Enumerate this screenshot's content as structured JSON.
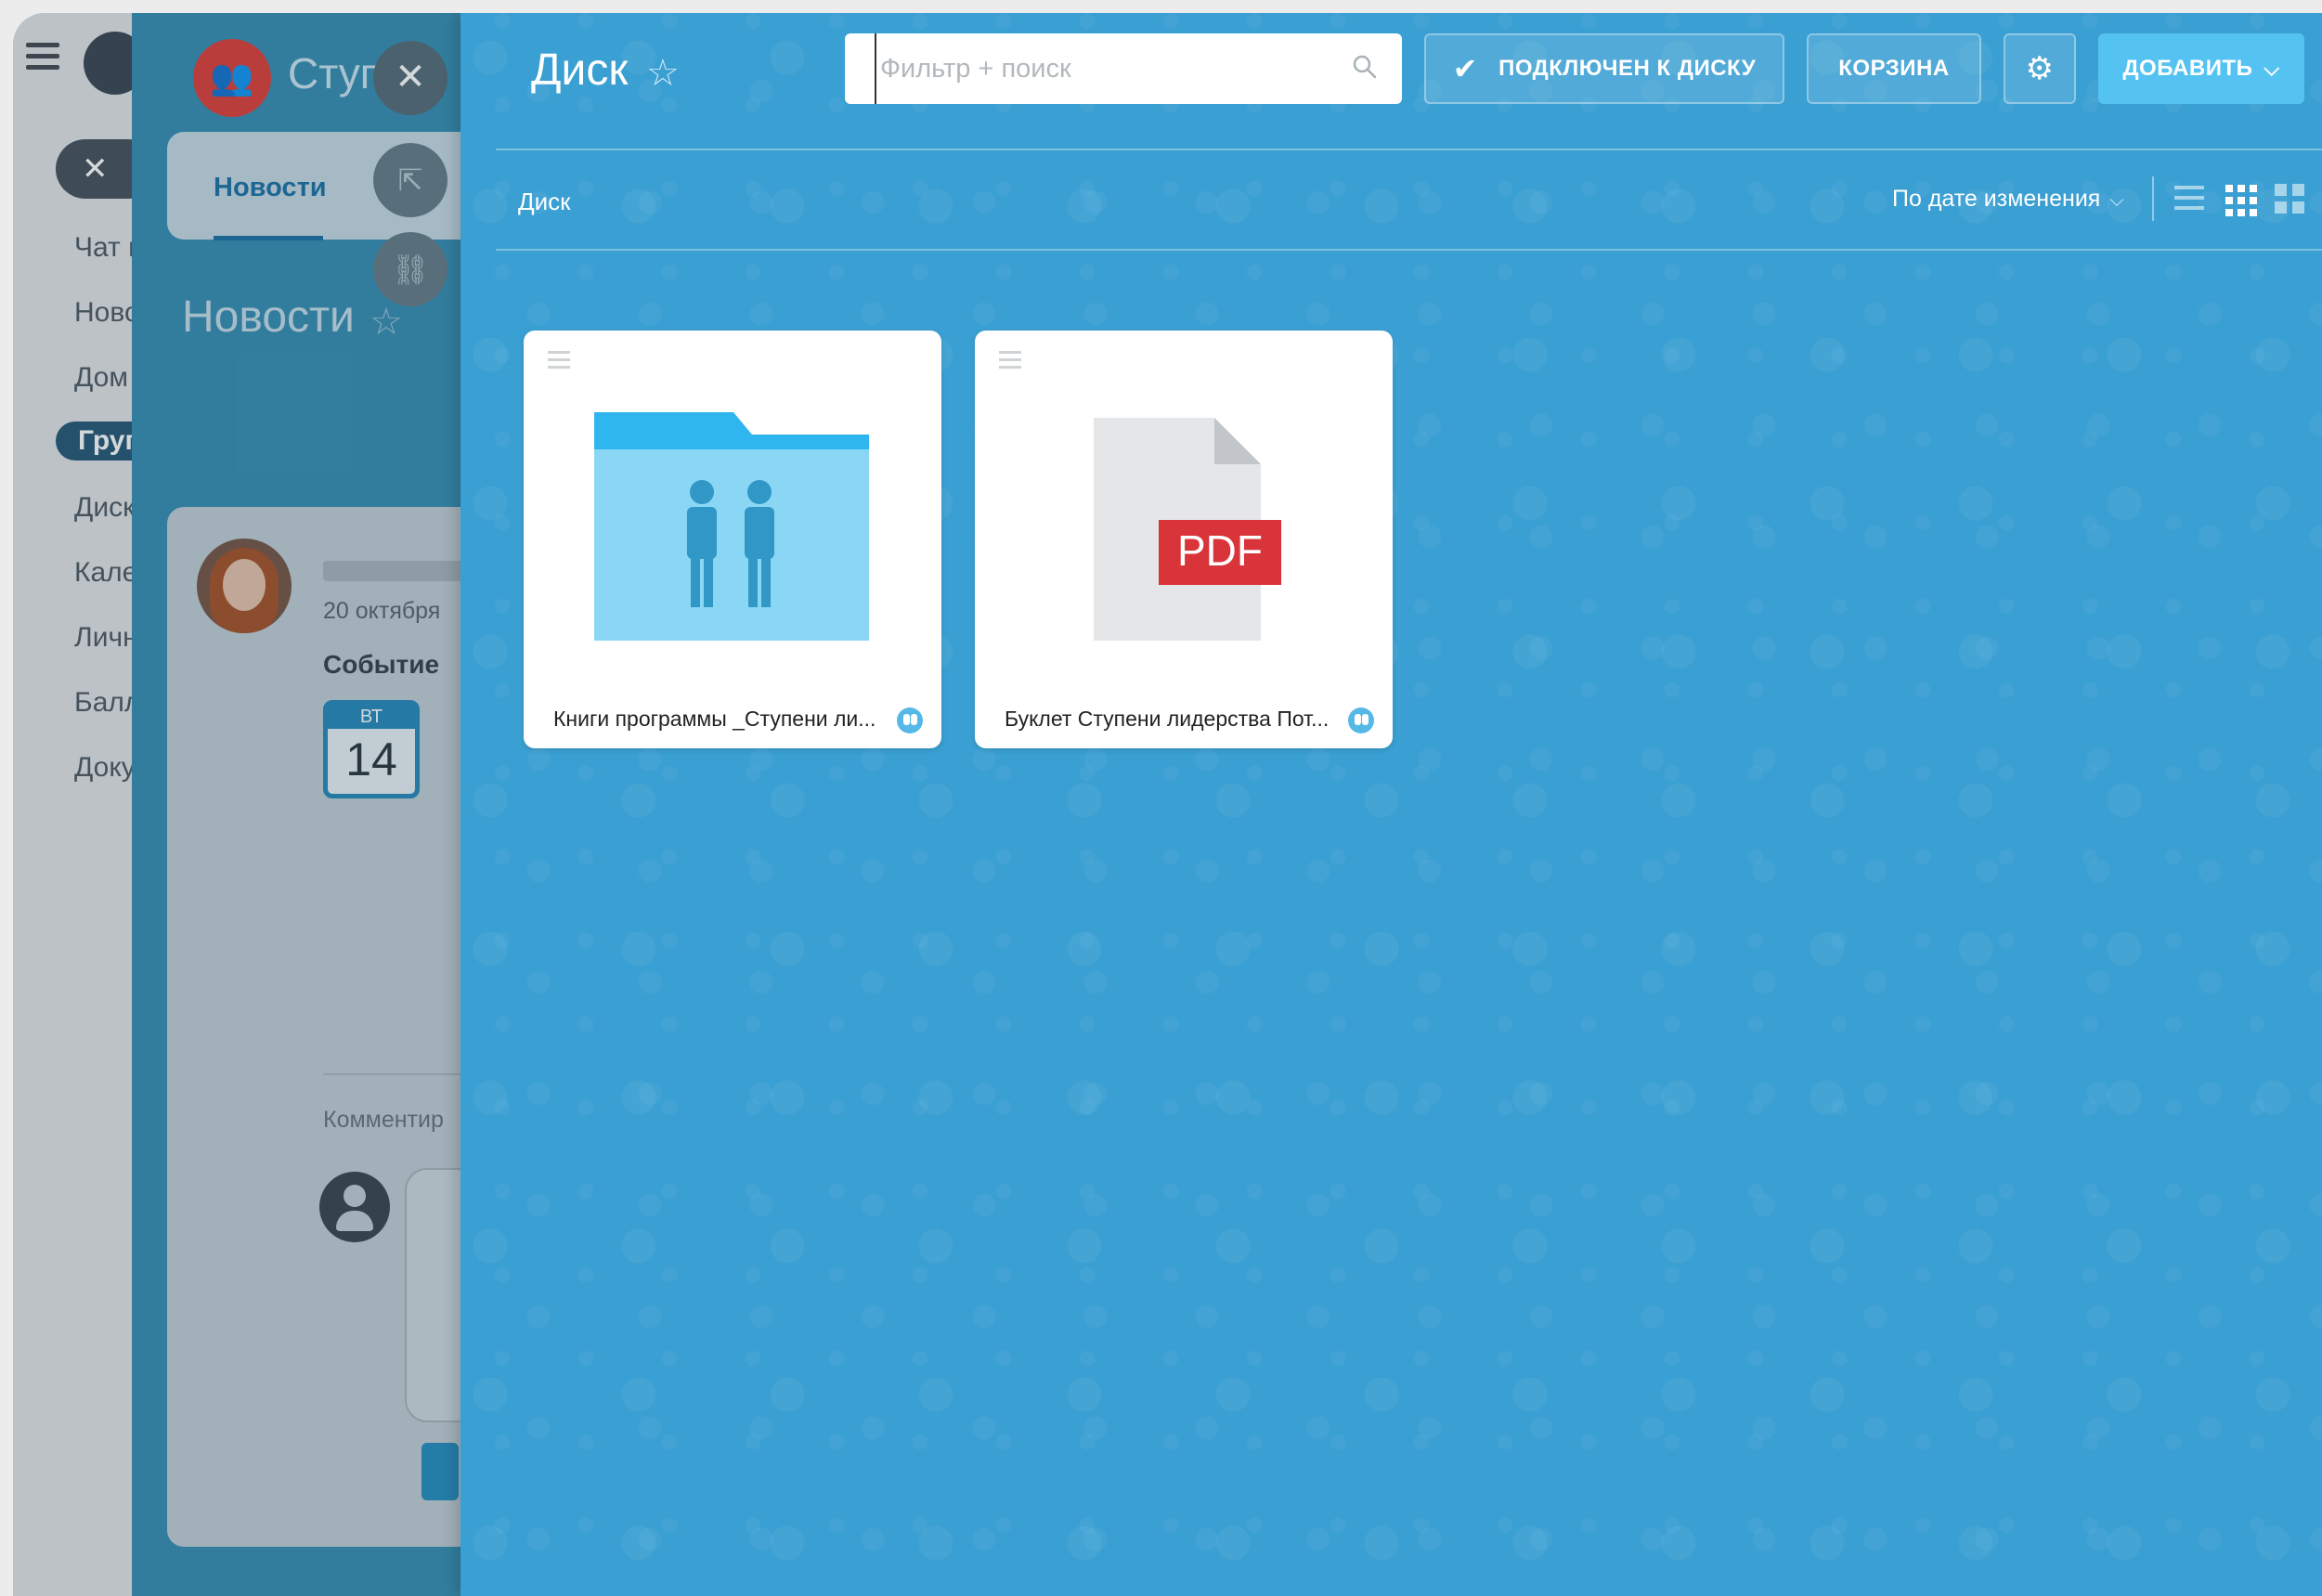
{
  "sidebar": {
    "items": [
      "Чат и",
      "Ново",
      "Дом",
      "Груп",
      "Диск",
      "Кале",
      "Личн",
      "Балл",
      "Доку"
    ]
  },
  "group": {
    "title": "Ступ",
    "tab_news": "Новости",
    "page_title": "Новости",
    "post": {
      "date": "20 октября",
      "event_label": "Событие",
      "cal_dow": "ВТ",
      "cal_day": "14",
      "comment_label": "Комментир"
    }
  },
  "disk": {
    "title": "Диск",
    "search": {
      "placeholder": "Фильтр + поиск"
    },
    "buttons": {
      "connected": "ПОДКЛЮЧЕН К ДИСКУ",
      "trash": "КОРЗИНА",
      "add": "ДОБАВИТЬ"
    },
    "breadcrumb": "Диск",
    "sort_label": "По дате изменения",
    "items": [
      {
        "name": "Книги программы _Ступени ли...",
        "type": "shared-folder"
      },
      {
        "name": "Буклет Ступени лидерства Пот...",
        "type": "pdf",
        "badge": "PDF"
      }
    ]
  },
  "colors": {
    "disk_bg": "#3a9fd2",
    "add_button": "#55c3f2",
    "folder": "#8ad7f5",
    "pdf_badge": "#d9343a"
  }
}
